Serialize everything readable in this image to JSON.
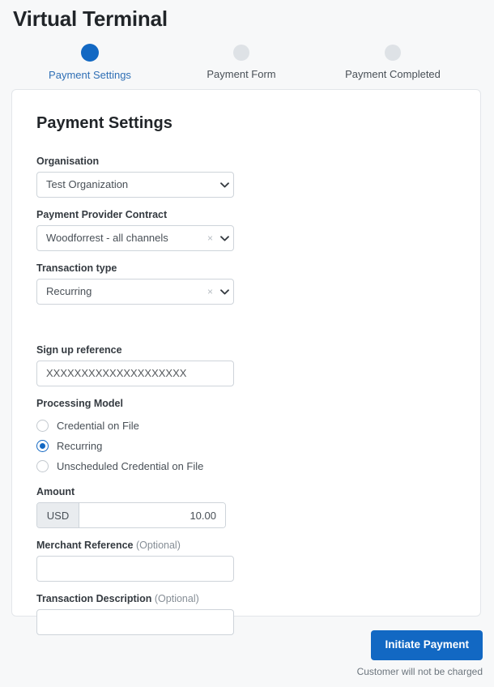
{
  "app": {
    "title": "Virtual Terminal",
    "accent_color": "#1268c3",
    "page_background": "#f7f8f9",
    "card_background": "#ffffff"
  },
  "stepper": {
    "steps": [
      {
        "label": "Payment Settings",
        "state": "active"
      },
      {
        "label": "Payment Form",
        "state": "inactive"
      },
      {
        "label": "Payment Completed",
        "state": "inactive"
      }
    ]
  },
  "card": {
    "heading": "Payment Settings",
    "fields": {
      "organisation": {
        "label": "Organisation",
        "value": "Test Organization",
        "chevron": "chevron-down-icon"
      },
      "payment_provider_contract": {
        "label": "Payment Provider Contract",
        "value": "Woodforrest - all channels",
        "clear": "×",
        "chevron": "chevron-down-icon"
      },
      "transaction_type": {
        "label": "Transaction type",
        "value": "Recurring",
        "clear": "×",
        "chevron": "chevron-down-icon"
      },
      "sign_up_reference": {
        "label": "Sign up reference",
        "value": "XXXXXXXXXXXXXXXXXXXX"
      },
      "processing_model": {
        "label": "Processing Model",
        "selected": "Recurring",
        "options": [
          {
            "label": "Credential on File",
            "checked": false
          },
          {
            "label": "Recurring",
            "checked": true
          },
          {
            "label": "Unscheduled Credential on File",
            "checked": false
          }
        ]
      },
      "amount": {
        "label": "Amount",
        "currency": "USD",
        "value": "10.00"
      },
      "merchant_reference": {
        "label": "Merchant Reference",
        "optional": "(Optional)",
        "value": ""
      },
      "transaction_description": {
        "label": "Transaction Description",
        "optional": "(Optional)",
        "value": ""
      }
    }
  },
  "footer": {
    "submit_label": "Initiate Payment",
    "note": "Customer will not be charged"
  }
}
